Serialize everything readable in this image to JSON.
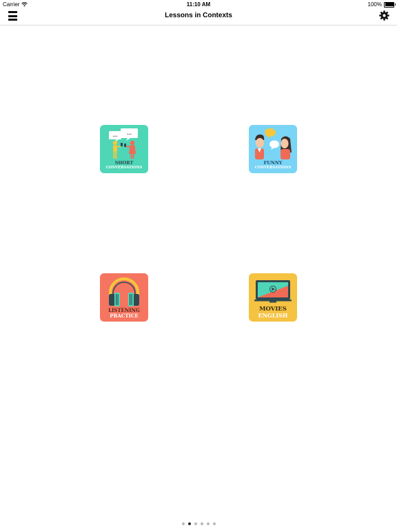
{
  "status_bar": {
    "carrier": "Carrier",
    "time": "11:10 AM",
    "battery": "100%"
  },
  "nav": {
    "title": "Lessons in Contexts",
    "menu_icon": "hamburger-menu-icon",
    "settings_icon": "gear-icon"
  },
  "tiles": [
    {
      "line1": "SHORT",
      "line2": "CONVERSATIONS",
      "bubble1": "...",
      "bubble2": "...",
      "color": "#4fd6b6",
      "text_color": "#2f4a52",
      "text_color2": "#ffffff"
    },
    {
      "line1": "FUNNY",
      "line2": "CONVERSATIONS",
      "color": "#79d4f5",
      "text_color": "#1c4c6b",
      "text_color2": "#ffffff"
    },
    {
      "line1": "LISTENING",
      "line2": "PRACTICE",
      "color": "#f57560",
      "text_color": "#5a2418",
      "text_color2": "#ffffff"
    },
    {
      "line1": "MOVIES",
      "line2": "ENGLISH",
      "color": "#f5c242",
      "text_color": "#3a2e14",
      "text_color2": "#ffffff"
    }
  ],
  "pager": {
    "count": 6,
    "active_index": 1
  }
}
